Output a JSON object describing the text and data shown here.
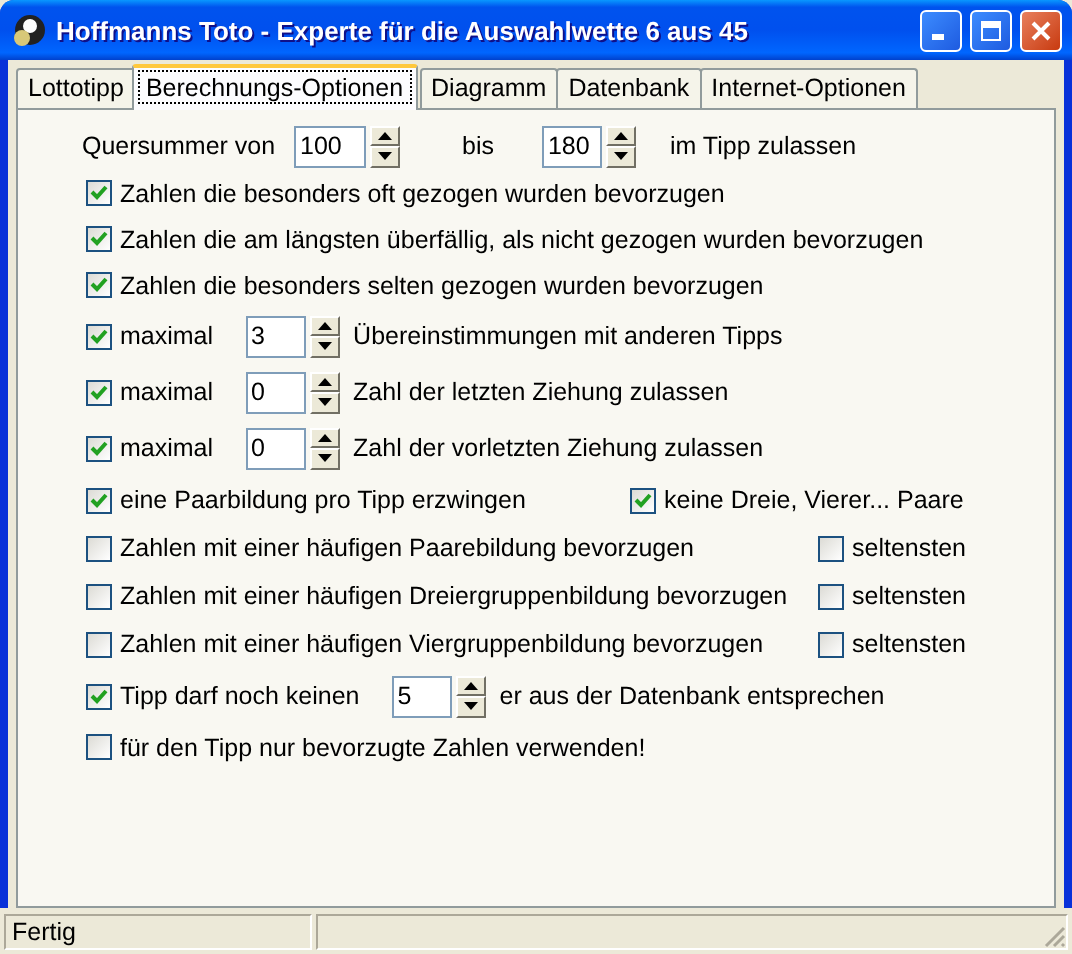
{
  "window": {
    "title": "Hoffmanns Toto - Experte für die Auswahlwette 6 aus 45"
  },
  "tabs": [
    {
      "label": "Lottotipp",
      "selected": false
    },
    {
      "label": "Berechnungs-Optionen",
      "selected": true
    },
    {
      "label": "Diagramm",
      "selected": false
    },
    {
      "label": "Datenbank",
      "selected": false
    },
    {
      "label": "Internet-Optionen",
      "selected": false
    }
  ],
  "options": [
    {
      "kind": "range",
      "label": "Quersummer von",
      "from": "100",
      "middle": "bis",
      "to": "180",
      "suffix": "im Tipp zulassen"
    },
    {
      "kind": "check",
      "checked": true,
      "label": "Zahlen die besonders oft gezogen wurden bevorzugen"
    },
    {
      "kind": "check",
      "checked": true,
      "label": "Zahlen die am längsten überfällig, als nicht gezogen wurden bevorzugen"
    },
    {
      "kind": "check",
      "checked": true,
      "label": "Zahlen die besonders selten gezogen wurden bevorzugen"
    },
    {
      "kind": "spin",
      "checked": true,
      "label": "maximal",
      "value": "3",
      "suffix": "Übereinstimmungen mit anderen Tipps"
    },
    {
      "kind": "spin",
      "checked": true,
      "label": "maximal",
      "value": "0",
      "suffix": "Zahl der letzten Ziehung zulassen"
    },
    {
      "kind": "spin",
      "checked": true,
      "label": "maximal",
      "value": "0",
      "suffix": "Zahl der vorletzten Ziehung zulassen"
    },
    {
      "kind": "pair",
      "checked": true,
      "label": "eine Paarbildung pro Tipp erzwingen",
      "second": {
        "checked": true,
        "label": "keine Dreie, Vierer... Paare"
      }
    },
    {
      "kind": "pair_wide",
      "checked": false,
      "label": "Zahlen mit einer häufigen Paarebildung bevorzugen",
      "second": {
        "checked": false,
        "label": "seltensten"
      }
    },
    {
      "kind": "pair_wide",
      "checked": false,
      "label": "Zahlen mit einer häufigen Dreiergruppenbildung bevorzugen",
      "second": {
        "checked": false,
        "label": "seltensten"
      }
    },
    {
      "kind": "pair_wide",
      "checked": false,
      "label": "Zahlen mit einer häufigen Viergruppenbildung bevorzugen",
      "second": {
        "checked": false,
        "label": "seltensten"
      }
    },
    {
      "kind": "spin",
      "checked": true,
      "label": "Tipp darf noch keinen",
      "value": "5",
      "suffix": "er aus der Datenbank entsprechen"
    },
    {
      "kind": "check",
      "checked": false,
      "label": "für den Tipp nur bevorzugte Zahlen verwenden!"
    }
  ],
  "status_bar": {
    "text": "Fertig"
  }
}
